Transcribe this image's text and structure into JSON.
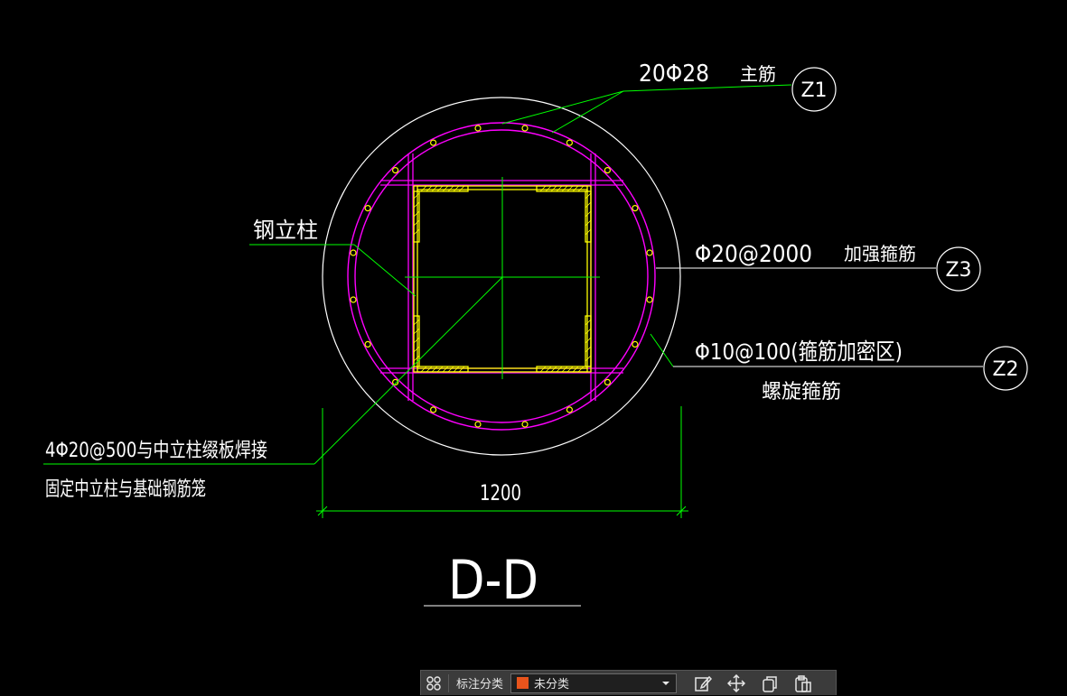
{
  "colors": {
    "background": "#000000",
    "outline": "#ffffff",
    "rebar": "#ff00ff",
    "steel": "#ffff00",
    "dimension": "#00ff00",
    "text": "#ffffff",
    "category_swatch": "#e8541c"
  },
  "labels": {
    "main_bar_spec": "20Φ28",
    "main_bar_name": "主筋",
    "z1": "Z1",
    "steel_column": "钢立柱",
    "strong_hoop_spec": "Φ20@2000",
    "strong_hoop_name": "加强箍筋",
    "z3": "Z3",
    "spiral_spec": "Φ10@100(箍筋加密区)",
    "spiral_name": "螺旋箍筋",
    "z2": "Z2",
    "note_line1": "4Φ20@500与中立柱缀板焊接",
    "note_line2": "固定中立柱与基础钢筋笼",
    "dimension": "1200",
    "section_title": "D-D"
  },
  "toolbar": {
    "category_label": "标注分类",
    "category_value": "未分类",
    "icons": [
      "grid-icon",
      "edit-icon",
      "move-icon",
      "copy-icon",
      "paste-icon"
    ]
  }
}
